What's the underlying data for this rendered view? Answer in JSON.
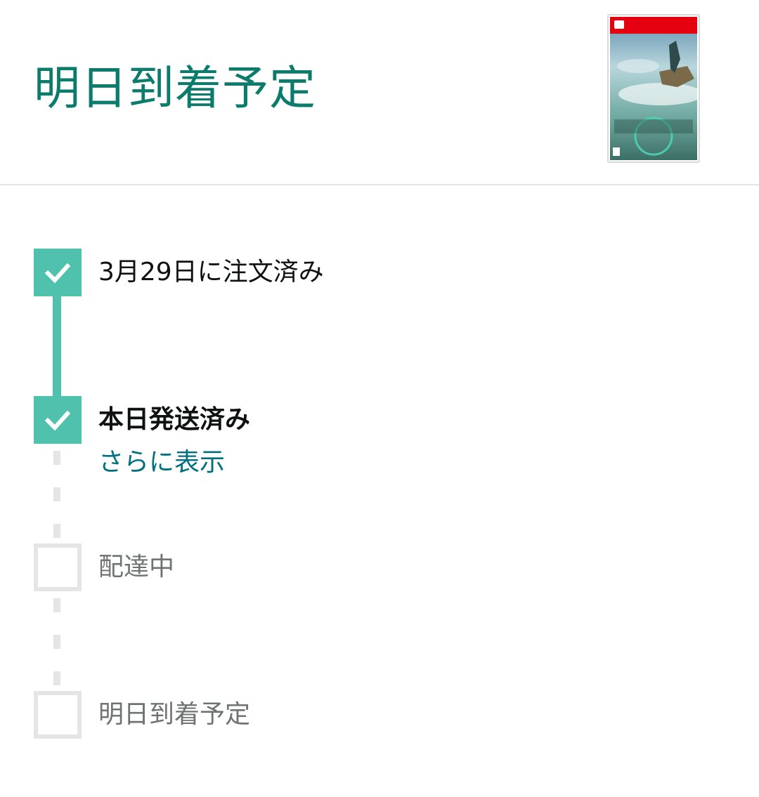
{
  "header": {
    "title": "明日到着予定",
    "product_image_icon": "game-box-art-image"
  },
  "timeline": {
    "steps": [
      {
        "label": "3月29日に注文済み",
        "status": "done"
      },
      {
        "label": "本日発送済み",
        "status": "done",
        "emphasis": "bold",
        "more_link": "さらに表示"
      },
      {
        "label": "配達中",
        "status": "pending"
      },
      {
        "label": "明日到着予定",
        "status": "pending"
      }
    ]
  },
  "colors": {
    "accent": "#0b7b6b",
    "progress": "#4fc1ad",
    "link": "#00707f",
    "pending_border": "#e5e5e5"
  }
}
